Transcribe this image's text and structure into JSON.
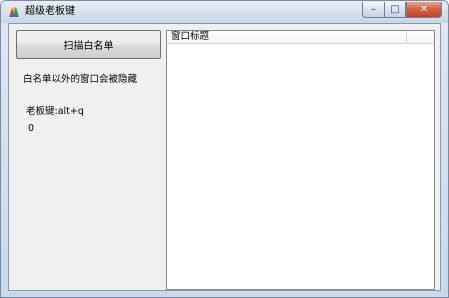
{
  "window": {
    "title": "超级老板键",
    "min_glyph": "–",
    "max_glyph": "□",
    "close_glyph": "✕"
  },
  "main": {
    "scan_button_label": "扫描白名单",
    "info_text": "白名单以外的窗口会被隐藏",
    "hotkey_text": "老板键:alt+q",
    "counter_value": "0"
  },
  "list": {
    "columns": [
      "窗口标题"
    ],
    "rows": []
  },
  "colors": {
    "close_button": "#c8502f",
    "client_background": "#f0f0f0",
    "list_background": "#ffffff"
  }
}
